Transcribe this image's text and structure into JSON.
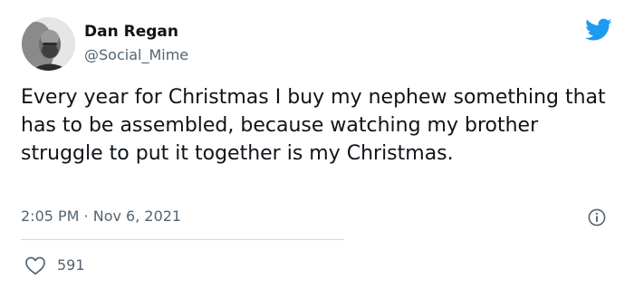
{
  "author": {
    "name": "Dan Regan",
    "handle": "@Social_Mime"
  },
  "tweet": {
    "text": "Every year for Christmas I buy my nephew something that has to be assembled, because watching my brother struggle to put it together is my Christmas.",
    "timestamp": "2:05 PM · Nov 6, 2021"
  },
  "engagement": {
    "likes": "591"
  },
  "icons": {
    "brand": "twitter-bird-icon",
    "info": "info-icon",
    "like": "heart-icon"
  },
  "colors": {
    "brand_blue": "#1d9bf0",
    "text_primary": "#0f1419",
    "text_secondary": "#536471",
    "divider": "#cfd9de"
  }
}
